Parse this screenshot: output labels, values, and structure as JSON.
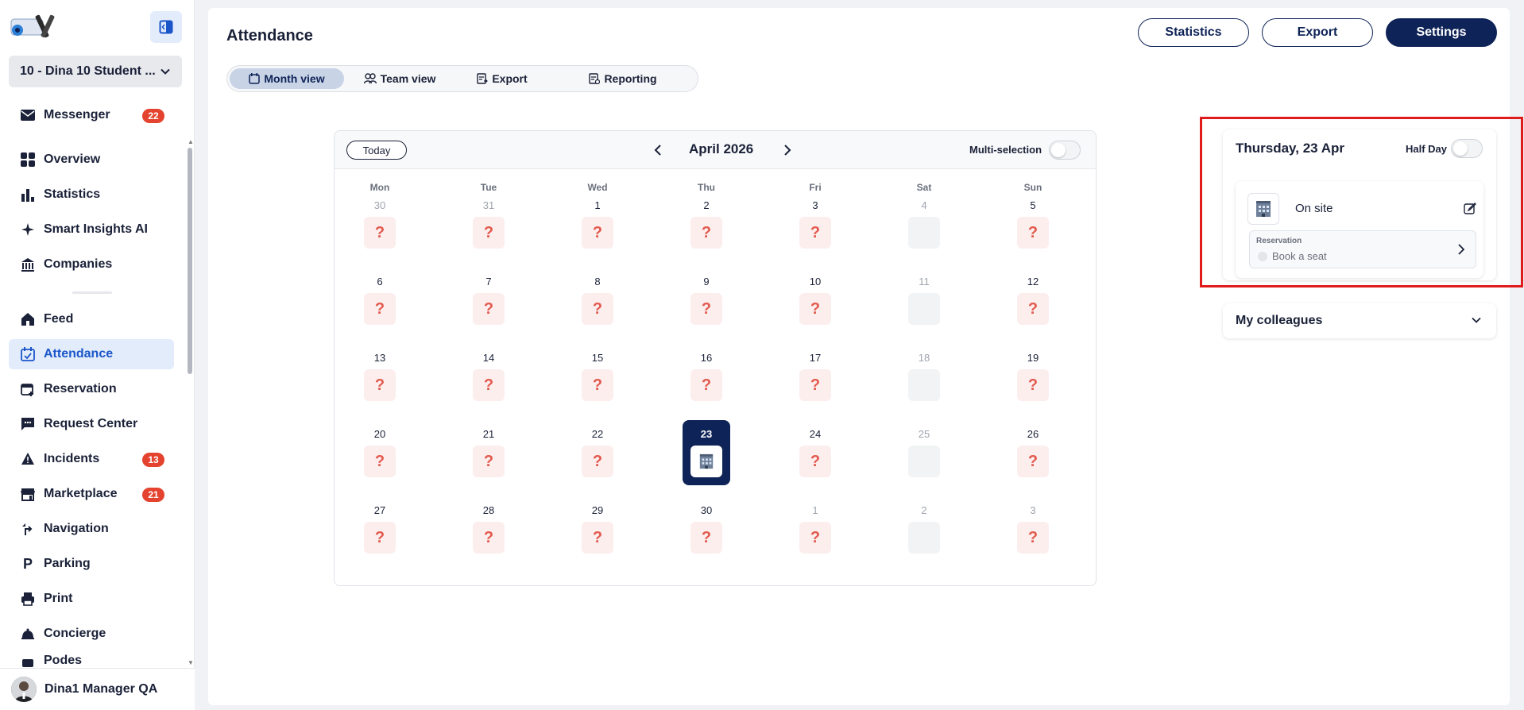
{
  "sidebar": {
    "org_name": "10 - Dina 10 Student ...",
    "messenger": {
      "label": "Messenger",
      "badge": "22"
    },
    "items_top": [
      {
        "label": "Overview",
        "icon": "grid-icon"
      },
      {
        "label": "Statistics",
        "icon": "bar-chart-icon"
      },
      {
        "label": "Smart Insights AI",
        "icon": "sparkle-icon"
      },
      {
        "label": "Companies",
        "icon": "bank-icon"
      }
    ],
    "items": [
      {
        "label": "Feed",
        "icon": "home-icon"
      },
      {
        "label": "Attendance",
        "icon": "calendar-check-icon"
      },
      {
        "label": "Reservation",
        "icon": "calendar-add-icon"
      },
      {
        "label": "Request Center",
        "icon": "chat-icon"
      },
      {
        "label": "Incidents",
        "icon": "warning-icon",
        "badge": "13"
      },
      {
        "label": "Marketplace",
        "icon": "store-icon",
        "badge": "21"
      },
      {
        "label": "Navigation",
        "icon": "route-icon"
      },
      {
        "label": "Parking",
        "icon": "parking-icon"
      },
      {
        "label": "Print",
        "icon": "printer-icon"
      },
      {
        "label": "Concierge",
        "icon": "bell-icon"
      },
      {
        "label": "Podes",
        "icon": "pod-icon"
      }
    ],
    "user_name": "Dina1 Manager QA"
  },
  "header": {
    "title": "Attendance",
    "statistics_label": "Statistics",
    "export_label": "Export",
    "settings_label": "Settings"
  },
  "tabs": [
    {
      "label": "Month view"
    },
    {
      "label": "Team view"
    },
    {
      "label": "Export"
    },
    {
      "label": "Reporting"
    }
  ],
  "calendar": {
    "today_label": "Today",
    "month_label": "April 2026",
    "multi_label": "Multi-selection",
    "weekdays": [
      "Mon",
      "Tue",
      "Wed",
      "Thu",
      "Fri",
      "Sat",
      "Sun"
    ],
    "weeks": [
      [
        "30",
        "31",
        "1",
        "2",
        "3",
        "4",
        "5"
      ],
      [
        "6",
        "7",
        "8",
        "9",
        "10",
        "11",
        "12"
      ],
      [
        "13",
        "14",
        "15",
        "16",
        "17",
        "18",
        "19"
      ],
      [
        "20",
        "21",
        "22",
        "23",
        "24",
        "25",
        "26"
      ],
      [
        "27",
        "28",
        "29",
        "30",
        "1",
        "2",
        "3"
      ]
    ],
    "unknown_symbol": "?"
  },
  "detail": {
    "date": "Thursday, 23 Apr",
    "half_day_label": "Half Day",
    "status": "On site",
    "reservation_label": "Reservation",
    "reservation_value": "Book a seat"
  },
  "colleagues_label": "My colleagues",
  "colors": {
    "navy": "#0e2357",
    "accent_blue": "#1a56c9",
    "unknown_red": "#e25a4e",
    "badge_red": "#e4442f",
    "highlight_red": "#e01b1b"
  }
}
